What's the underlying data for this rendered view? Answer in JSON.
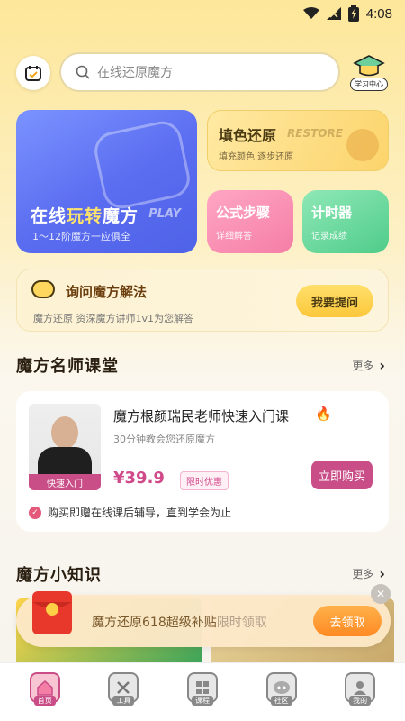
{
  "status": {
    "time": "4:08"
  },
  "search": {
    "placeholder": "在线还原魔方"
  },
  "study_center": {
    "label": "学习中心"
  },
  "cards": {
    "play": {
      "title_a": "在线",
      "title_hl": "玩转",
      "title_b": "魔方",
      "en": "PLAY",
      "sub": "1～12阶魔方一应俱全"
    },
    "color": {
      "title": "填色还原",
      "en": "RESTORE",
      "sub": "填充颜色 逐步还原"
    },
    "formula": {
      "title": "公式步骤",
      "sub": "详细解答"
    },
    "timer": {
      "title": "计时器",
      "sub": "记录成绩"
    }
  },
  "ask": {
    "title": "询问魔方解法",
    "sub": "魔方还原 资深魔方讲师1v1为您解答",
    "button": "我要提问"
  },
  "section_teachers": {
    "title": "魔方名师课堂",
    "more": "更多"
  },
  "course": {
    "photo_tag": "快速入门",
    "title": "魔方根颜瑞民老师快速入门课",
    "sub": "30分钟教会您还原魔方",
    "price": "¥39.9",
    "badge": "限时优惠",
    "buy": "立即购买",
    "note": "购买即赠在线课后辅导，直到学会为止"
  },
  "section_tips": {
    "title": "魔方小知识",
    "more": "更多"
  },
  "promo": {
    "text": "魔方还原618超级补贴",
    "light": "限时领取",
    "button": "去领取"
  },
  "nav": [
    {
      "label": "首页"
    },
    {
      "label": "工具"
    },
    {
      "label": "课程"
    },
    {
      "label": "社区"
    },
    {
      "label": "我的"
    }
  ],
  "colors": {
    "accent_pink": "#c94d87",
    "accent_yellow": "#fcc73b",
    "play_blue": "#5a6cf0",
    "timer_green": "#4fcc8a"
  }
}
